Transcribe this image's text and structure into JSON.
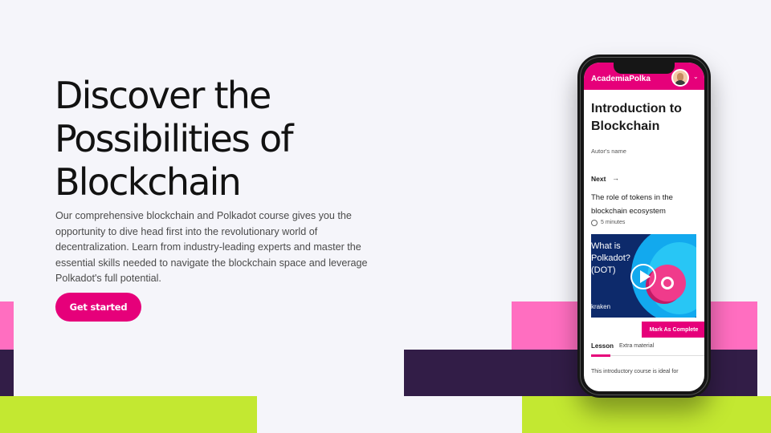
{
  "hero": {
    "title_lines": [
      "Discover the",
      "Possibilities of",
      "Blockchain"
    ],
    "description": "Our comprehensive blockchain and Polkadot course gives you the opportunity to dive head first into the revolutionary world of decentralization. Learn from industry-leading experts and master the essential skills needed to navigate the blockchain space and leverage Polkadot's full potential.",
    "cta_label": "Get started"
  },
  "colors": {
    "accent": "#e6007a",
    "pink_block": "#ff6ec0",
    "plum_block": "#321d47",
    "lime_block": "#c3e831",
    "background": "#f5f5fa"
  },
  "phone": {
    "app_name": "AcademiaPolka",
    "course_title": "Introduction to Blockchain",
    "author": "Autor's name",
    "next_label": "Next",
    "next_arrow": "→",
    "chevron": "⌄",
    "next_lesson_title": "The role of tokens in the blockchain ecosystem",
    "duration": "5 minutes",
    "video": {
      "overlay_text": "What is Polkadot? (DOT)",
      "brand": "kraken"
    },
    "mark_complete_label": "Mark As Complete",
    "tabs": [
      "Lesson",
      "Extra material"
    ],
    "intro_text": "This introductory course is ideal for"
  },
  "icons": [
    "avatar",
    "chevron-down-icon",
    "arrow-right-icon",
    "clock-icon",
    "play-icon"
  ]
}
